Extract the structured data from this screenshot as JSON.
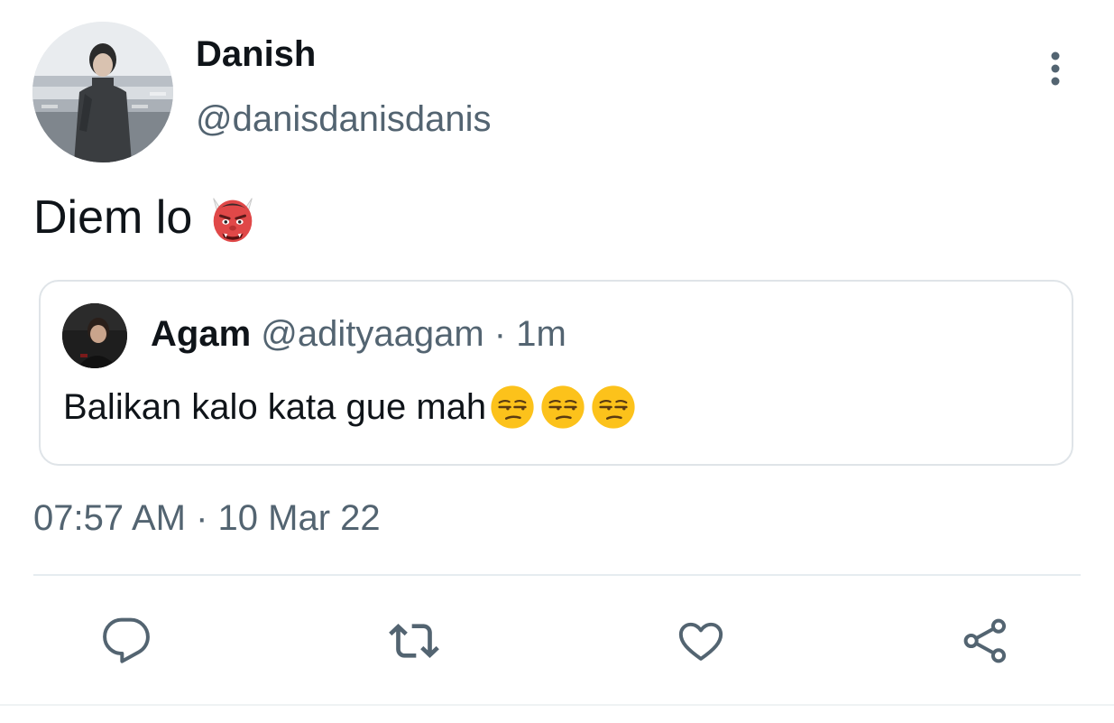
{
  "author": {
    "display_name": "Danish",
    "handle": "@danisdanisdanis",
    "avatar": "profile-photo"
  },
  "tweet": {
    "text": "Diem lo",
    "emoji": "japanese-ogre-emoji",
    "timestamp": "07:57 AM · 10 Mar 22"
  },
  "quoted_tweet": {
    "display_name": "Agam",
    "handle": "@adityaagam",
    "separator": "·",
    "time": "1m",
    "text": "Balikan kalo kata gue mah",
    "emojis": [
      "unamused-face-emoji",
      "unamused-face-emoji",
      "unamused-face-emoji"
    ]
  },
  "actions": {
    "icons": [
      "reply-icon",
      "retweet-icon",
      "like-icon",
      "share-icon"
    ]
  },
  "colors": {
    "text_primary": "#0f1419",
    "text_secondary": "#536471",
    "border": "#dfe4e8",
    "icon": "#536471"
  }
}
